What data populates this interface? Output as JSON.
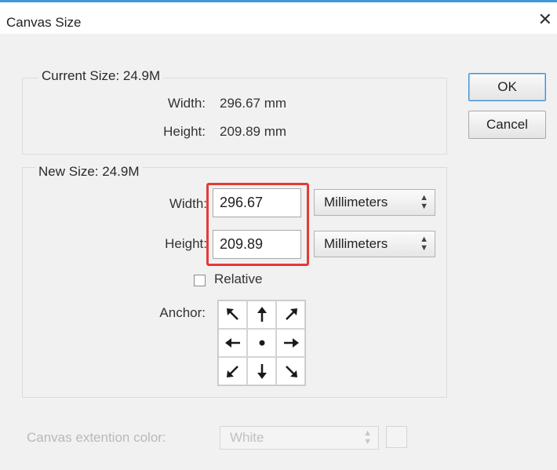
{
  "window": {
    "title": "Canvas Size",
    "close_icon": "close-icon"
  },
  "current_size": {
    "label": "Current Size: 24.9M",
    "width_label": "Width:",
    "width_value": "296.67 mm",
    "height_label": "Height:",
    "height_value": "209.89 mm"
  },
  "new_size": {
    "label": "New Size: 24.9M",
    "width_label": "Width:",
    "width_value": "296.67",
    "width_unit": "Millimeters",
    "height_label": "Height:",
    "height_value": "209.89",
    "height_unit": "Millimeters",
    "relative_label": "Relative",
    "relative_checked": false,
    "anchor_label": "Anchor:"
  },
  "buttons": {
    "ok": "OK",
    "cancel": "Cancel"
  },
  "extension": {
    "label": "Canvas extention color:",
    "value": "White"
  },
  "colors": {
    "highlight": "#e53a35",
    "title_accent": "#3e9ad6"
  }
}
